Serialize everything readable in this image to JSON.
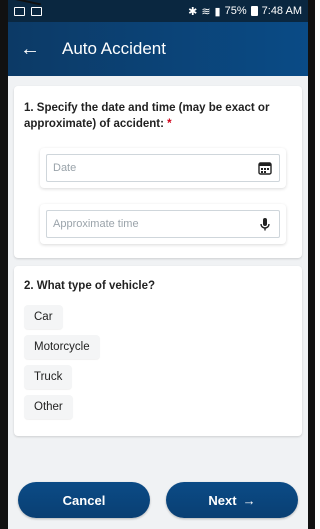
{
  "status_bar": {
    "battery": "75%",
    "time": "7:48 AM",
    "left_icons": [
      "wifi-calling-icon",
      "image-icon"
    ],
    "right_icons": [
      "bluetooth-icon",
      "wifi-icon",
      "signal-icon",
      "battery-icon"
    ]
  },
  "appbar": {
    "title": "Auto Accident",
    "back_icon": "arrow-left-icon"
  },
  "question1": {
    "label": "1. Specify the date and time (may be exact or approximate) of accident:",
    "required_mark": "*",
    "date_placeholder": "Date",
    "time_placeholder": "Approximate time",
    "date_icon": "calendar-icon",
    "time_icon": "microphone-icon"
  },
  "question2": {
    "label": "2. What type of vehicle?",
    "options": [
      "Car",
      "Motorcycle",
      "Truck",
      "Other"
    ]
  },
  "buttons": {
    "cancel_label": "Cancel",
    "next_label": "Next",
    "next_icon": "arrow-right-icon"
  },
  "colors": {
    "primary": "#0A4B86",
    "required": "#D0021B"
  }
}
